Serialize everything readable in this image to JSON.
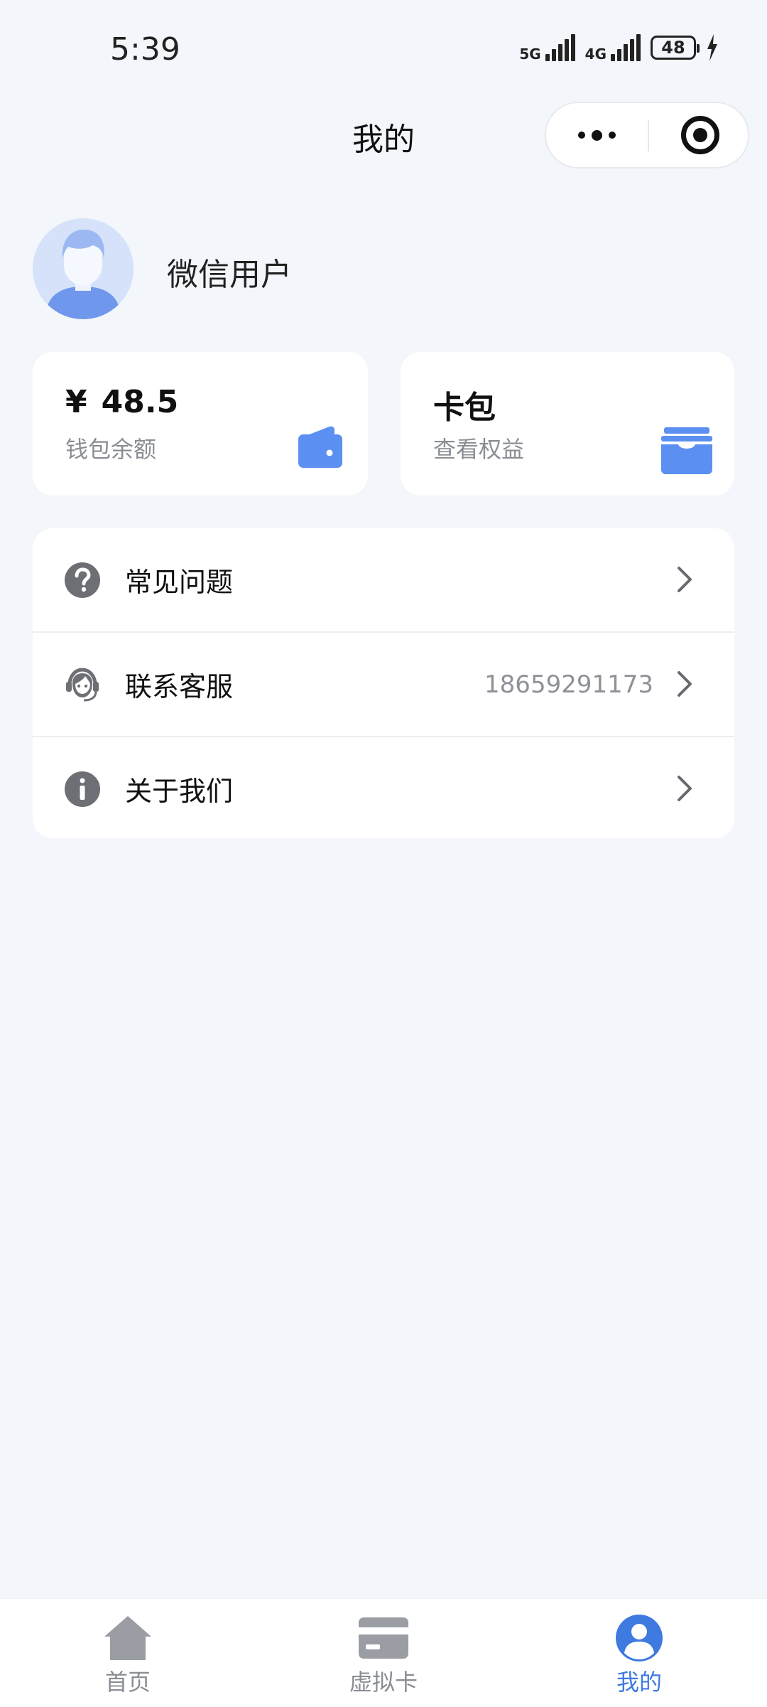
{
  "status_bar": {
    "time": "5:39",
    "network_1": "5G",
    "network_2": "4G",
    "battery_level": "48"
  },
  "nav": {
    "title": "我的",
    "capsule_more_icon": "more-dots-icon",
    "capsule_close_icon": "target-circle-icon"
  },
  "profile": {
    "name": "微信用户",
    "avatar_icon": "default-avatar"
  },
  "wallet_card": {
    "currency": "¥",
    "amount": "48.5",
    "subtitle": "钱包余额",
    "icon": "wallet-icon"
  },
  "pack_card": {
    "title": "卡包",
    "subtitle": "查看权益",
    "icon": "card-pack-icon"
  },
  "menu": {
    "items": [
      {
        "label": "常见问题",
        "value": "",
        "icon": "question-circle-icon"
      },
      {
        "label": "联系客服",
        "value": "18659291173",
        "icon": "customer-service-icon"
      },
      {
        "label": "关于我们",
        "value": "",
        "icon": "info-circle-icon"
      }
    ]
  },
  "tabbar": {
    "tabs": [
      {
        "label": "首页",
        "icon": "home-icon",
        "active": false
      },
      {
        "label": "虚拟卡",
        "icon": "card-icon",
        "active": false
      },
      {
        "label": "我的",
        "icon": "user-icon",
        "active": true
      }
    ]
  },
  "colors": {
    "background": "#f3f6fb",
    "accent": "#3f7ae0",
    "icon_blue": "#5b8ff2",
    "icon_gray": "#6d6f75"
  }
}
